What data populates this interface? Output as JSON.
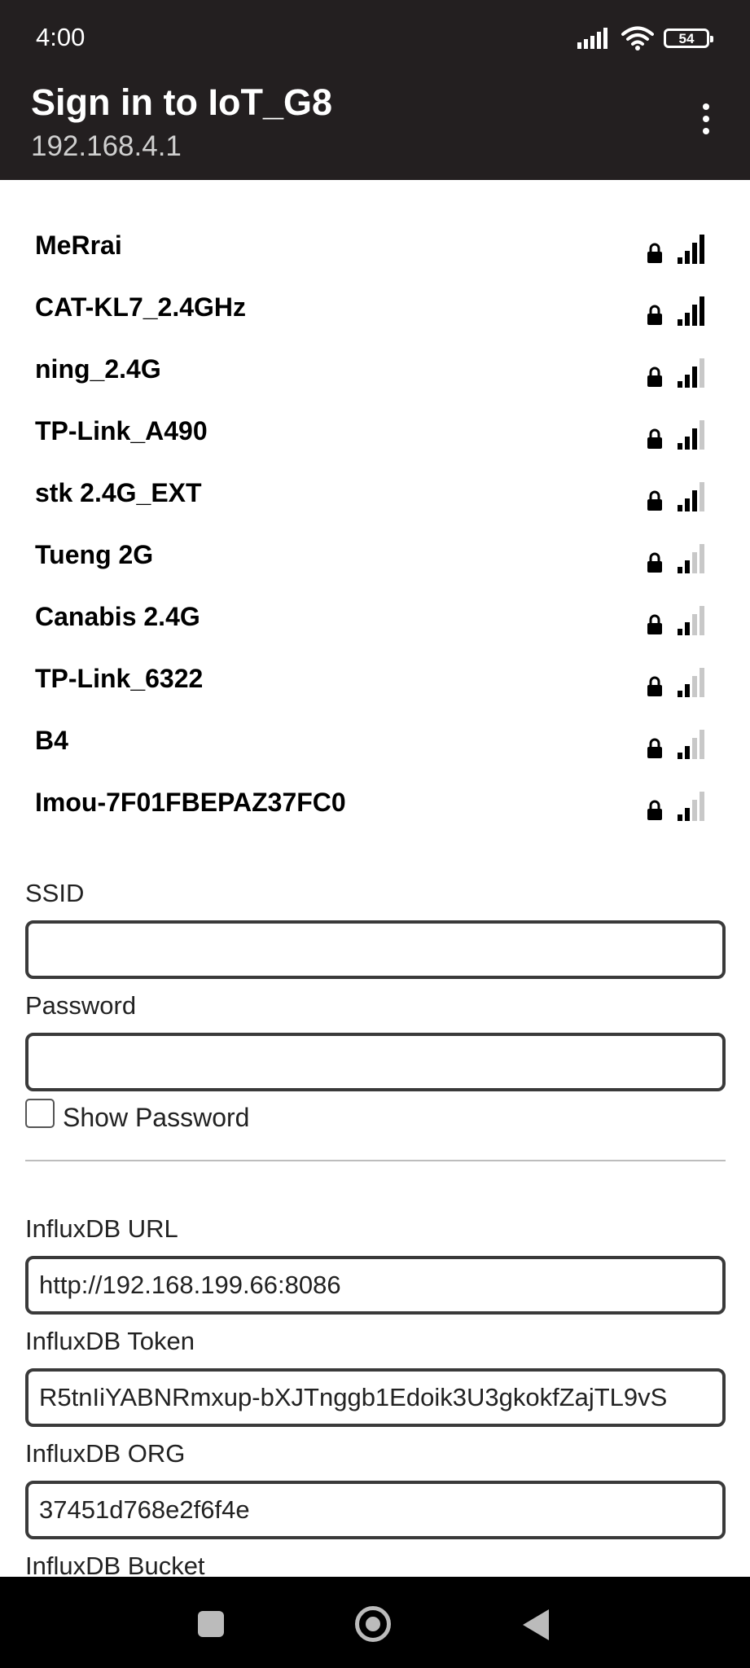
{
  "status_bar": {
    "time": "4:00",
    "battery": "54"
  },
  "app_bar": {
    "title": "Sign in to IoT_G8",
    "subtitle": "192.168.4.1"
  },
  "networks": [
    {
      "name": "MeRrai",
      "signal_bars": 4
    },
    {
      "name": "CAT-KL7_2.4GHz",
      "signal_bars": 4
    },
    {
      "name": "ning_2.4G",
      "signal_bars": 3
    },
    {
      "name": "TP-Link_A490",
      "signal_bars": 3
    },
    {
      "name": "stk 2.4G_EXT",
      "signal_bars": 3
    },
    {
      "name": "Tueng 2G",
      "signal_bars": 2
    },
    {
      "name": "Canabis 2.4G",
      "signal_bars": 2
    },
    {
      "name": "TP-Link_6322",
      "signal_bars": 2
    },
    {
      "name": "B4",
      "signal_bars": 2
    },
    {
      "name": "Imou-7F01FBEPAZ37FC0",
      "signal_bars": 2
    }
  ],
  "form": {
    "ssid_label": "SSID",
    "ssid_value": "",
    "password_label": "Password",
    "password_value": "",
    "show_password_label": "Show Password",
    "influx_url_label": "InfluxDB URL",
    "influx_url_value": "http://192.168.199.66:8086",
    "influx_token_label": "InfluxDB Token",
    "influx_token_value": "R5tnIiYABNRmxup-bXJTnggb1Edoik3U3gkokfZajTL9vS",
    "influx_org_label": "InfluxDB ORG",
    "influx_org_value": "37451d768e2f6f4e",
    "influx_bucket_label": "InfluxDB Bucket"
  },
  "colors": {
    "app_bar": "#231f20",
    "nav_bar": "#000000",
    "field_border": "#3a3a3a"
  }
}
